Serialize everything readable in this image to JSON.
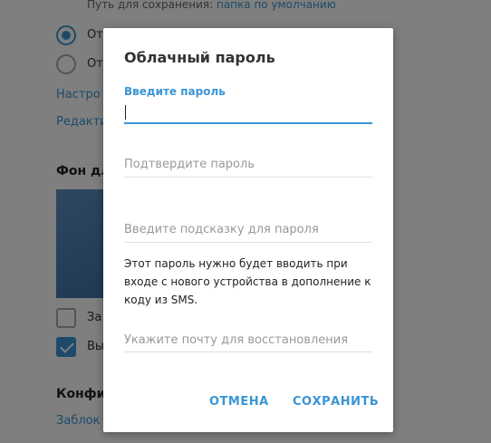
{
  "background": {
    "save_path_label": "Путь для сохранения:",
    "save_path_link": "папка по умолчанию",
    "radio_1_label": "От",
    "radio_2_label": "От",
    "link_1": "Настро",
    "link_2": "Редакти",
    "section_background": "Фон дл",
    "checkbox_1_label": "За",
    "checkbox_2_label": "Вы",
    "section_privacy": "Конфи",
    "link_3": "Заблок"
  },
  "dialog": {
    "title": "Облачный пароль",
    "password": {
      "label": "Введите пароль",
      "value": ""
    },
    "confirm": {
      "placeholder": "Подтвердите пароль",
      "value": ""
    },
    "hint": {
      "placeholder": "Введите подсказку для пароля",
      "value": ""
    },
    "info_text": "Этот пароль нужно будет вводить при входе с нового устройства в дополнение к коду из SMS.",
    "email": {
      "placeholder": "Укажите почту для восстановления",
      "value": ""
    },
    "cancel_label": "ОТМЕНА",
    "save_label": "СОХРАНИТЬ"
  },
  "colors": {
    "accent": "#3a95d5",
    "overlay": "rgba(0,0,0,0.5)"
  }
}
